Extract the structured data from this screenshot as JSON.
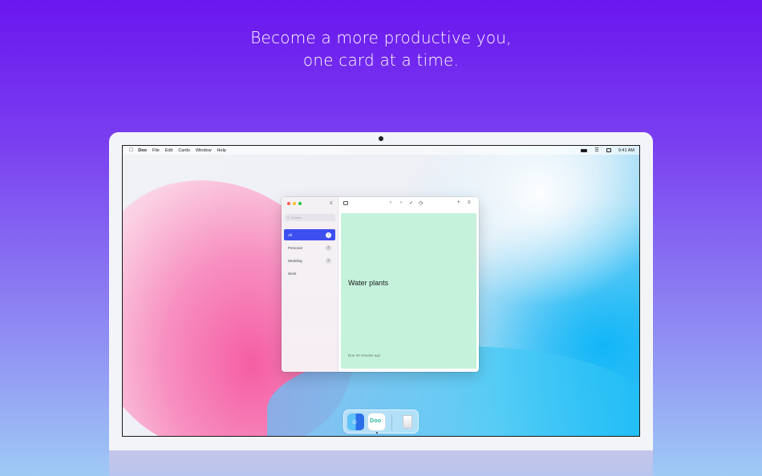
{
  "headline": {
    "line1": "Become a more productive you,",
    "line2": "one card at a time."
  },
  "menubar": {
    "app_name": "Doo",
    "menus": [
      "File",
      "Edit",
      "Cards",
      "Window",
      "Help"
    ],
    "time": "9:41 AM"
  },
  "sidebar": {
    "search_placeholder": "Search",
    "items": [
      {
        "label": "All",
        "count": "3",
        "active": true
      },
      {
        "label": "Personal",
        "count": "2",
        "active": false
      },
      {
        "label": "Wedding",
        "count": "1",
        "active": false
      },
      {
        "label": "Work",
        "count": "",
        "active": false
      }
    ]
  },
  "card": {
    "title": "Water plants",
    "due": "Due 20 minutes ago",
    "color": "#c5f2db"
  },
  "colors": {
    "accent": "#3e4ff0",
    "background_top": "#6a16ee",
    "background_bottom": "#9fcaf6"
  },
  "dock": {
    "apps": [
      "finder-icon",
      "doo-app-icon",
      "trash-icon"
    ],
    "doo_glyph": "Doo"
  }
}
